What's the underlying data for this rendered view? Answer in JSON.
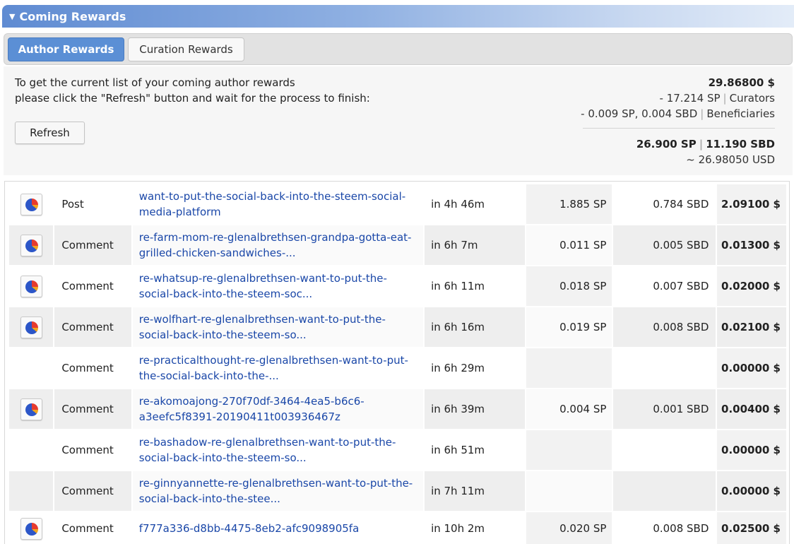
{
  "panel": {
    "title": "Coming Rewards"
  },
  "tabs": [
    {
      "label": "Author Rewards",
      "active": true
    },
    {
      "label": "Curation Rewards",
      "active": false
    }
  ],
  "info": {
    "line1": "To get the current list of your coming author rewards",
    "line2": "please click the \"Refresh\" button and wait for the process to finish:",
    "refresh_label": "Refresh"
  },
  "summary": {
    "total_usd": "29.86800 $",
    "curators_value": "- 17.214 SP",
    "curators_label": "Curators",
    "beneficiaries_value": "- 0.009 SP, 0.004 SBD",
    "beneficiaries_label": "Beneficiaries",
    "sp": "26.900 SP",
    "sbd": "11.190 SBD",
    "approx_usd": "~ 26.98050 USD"
  },
  "colors": {
    "header_blue": "#5f8bd2",
    "link_blue": "#1a47a8",
    "active_tab": "#5b8fd5"
  },
  "rows": [
    {
      "icon": "pie-chart-icon",
      "type": "Post",
      "link": "want-to-put-the-social-back-into-the-steem-social-media-platform",
      "time": "in 4h 46m",
      "sp": "1.885 SP",
      "sbd": "0.784 SBD",
      "total": "2.09100 $"
    },
    {
      "icon": "pie-chart-icon",
      "type": "Comment",
      "link": "re-farm-mom-re-glenalbrethsen-grandpa-gotta-eat-grilled-chicken-sandwiches-...",
      "time": "in 6h 7m",
      "sp": "0.011 SP",
      "sbd": "0.005 SBD",
      "total": "0.01300 $"
    },
    {
      "icon": "pie-chart-icon",
      "type": "Comment",
      "link": "re-whatsup-re-glenalbrethsen-want-to-put-the-social-back-into-the-steem-soc...",
      "time": "in 6h 11m",
      "sp": "0.018 SP",
      "sbd": "0.007 SBD",
      "total": "0.02000 $"
    },
    {
      "icon": "pie-chart-icon",
      "type": "Comment",
      "link": "re-wolfhart-re-glenalbrethsen-want-to-put-the-social-back-into-the-steem-so...",
      "time": "in 6h 16m",
      "sp": "0.019 SP",
      "sbd": "0.008 SBD",
      "total": "0.02100 $"
    },
    {
      "icon": "",
      "type": "Comment",
      "link": "re-practicalthought-re-glenalbrethsen-want-to-put-the-social-back-into-the-...",
      "time": "in 6h 29m",
      "sp": "",
      "sbd": "",
      "total": "0.00000 $"
    },
    {
      "icon": "pie-chart-icon",
      "type": "Comment",
      "link": "re-akomoajong-270f70df-3464-4ea5-b6c6-a3eefc5f8391-20190411t003936467z",
      "time": "in 6h 39m",
      "sp": "0.004 SP",
      "sbd": "0.001 SBD",
      "total": "0.00400 $"
    },
    {
      "icon": "",
      "type": "Comment",
      "link": "re-bashadow-re-glenalbrethsen-want-to-put-the-social-back-into-the-steem-so...",
      "time": "in 6h 51m",
      "sp": "",
      "sbd": "",
      "total": "0.00000 $"
    },
    {
      "icon": "",
      "type": "Comment",
      "link": "re-ginnyannette-re-glenalbrethsen-want-to-put-the-social-back-into-the-stee...",
      "time": "in 7h 11m",
      "sp": "",
      "sbd": "",
      "total": "0.00000 $"
    },
    {
      "icon": "pie-chart-icon",
      "type": "Comment",
      "link": "f777a336-d8bb-4475-8eb2-afc9098905fa",
      "time": "in 10h 2m",
      "sp": "0.020 SP",
      "sbd": "0.008 SBD",
      "total": "0.02500 $"
    }
  ]
}
